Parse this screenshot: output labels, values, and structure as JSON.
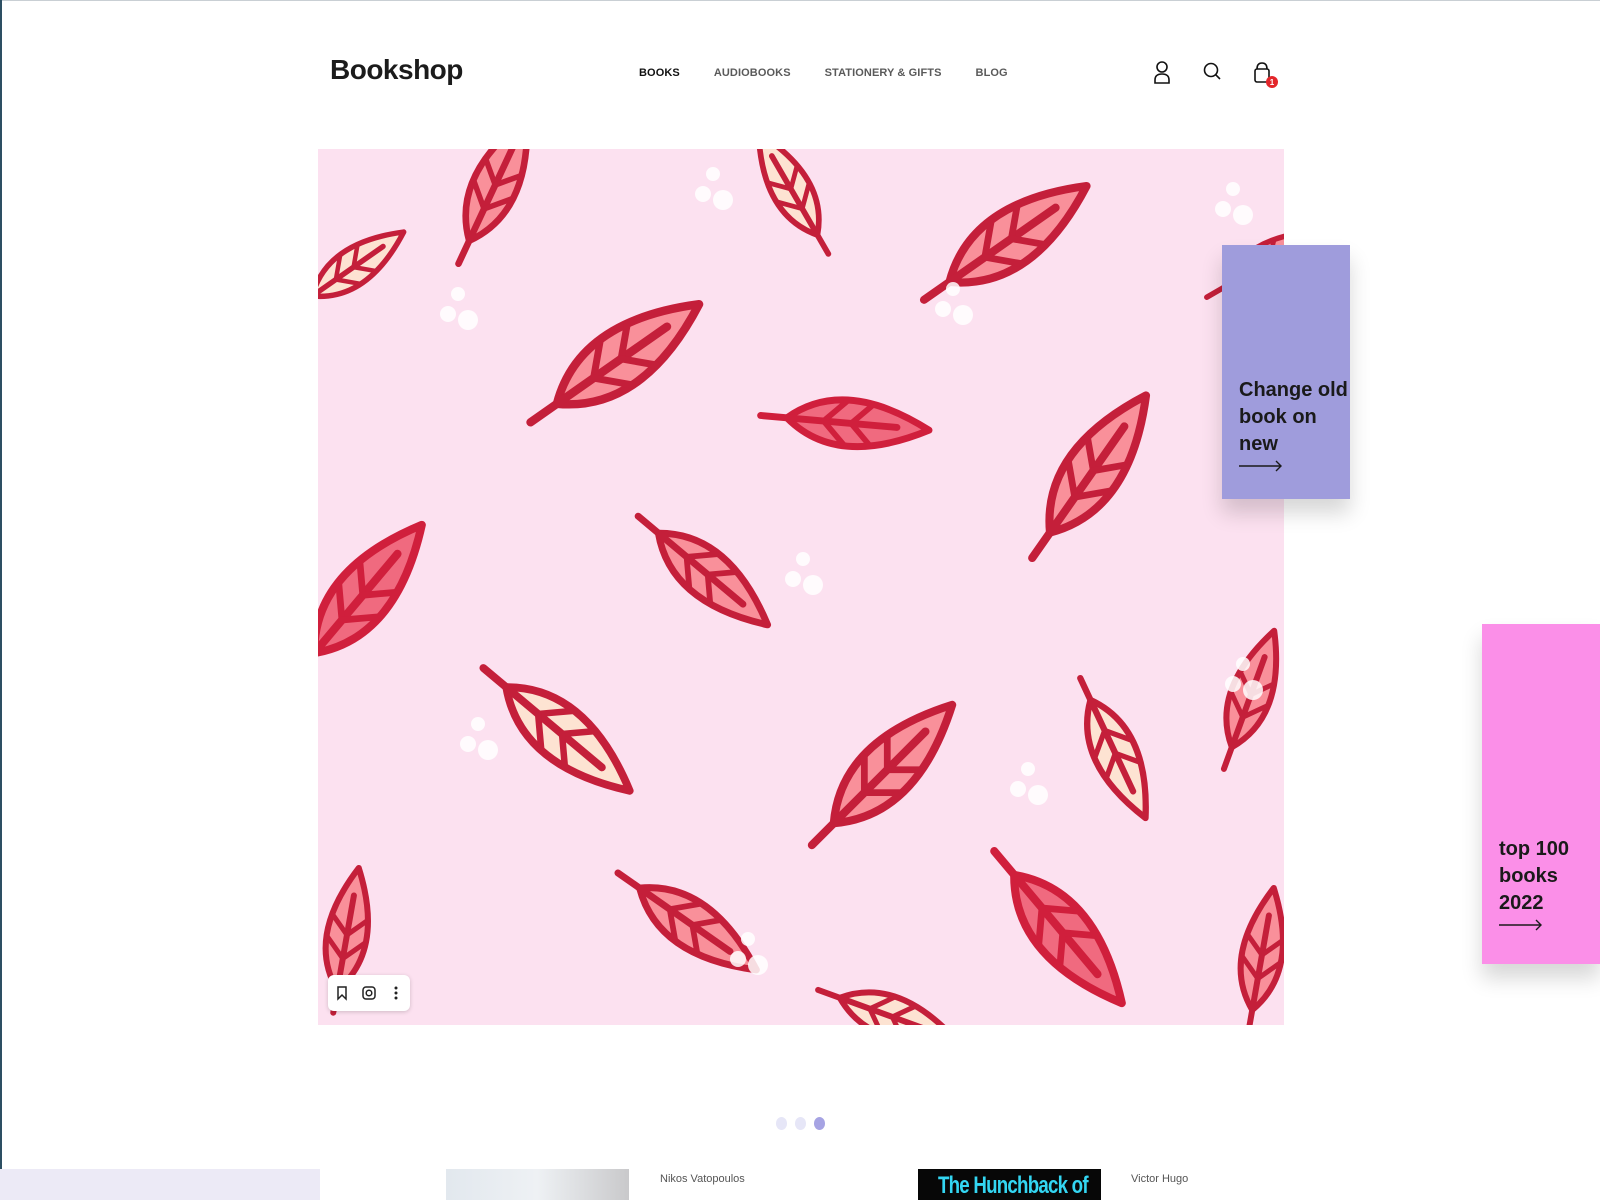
{
  "header": {
    "logo": "Bookshop",
    "nav": [
      {
        "label": "BOOKS",
        "active": true
      },
      {
        "label": "AUDIOBOOKS",
        "active": false
      },
      {
        "label": "STATIONERY & GIFTS",
        "active": false
      },
      {
        "label": "BLOG",
        "active": false
      }
    ],
    "icons": [
      "user-icon",
      "search-icon",
      "bag-icon"
    ],
    "cart_count": "1"
  },
  "hero": {
    "image": "pink leaf pattern",
    "toolbar_icons": [
      "bookmark-icon",
      "lens-icon",
      "more-icon"
    ]
  },
  "promos": [
    {
      "text_lines": [
        "Change old",
        "book on",
        "new"
      ],
      "color": "#9f9cdc"
    },
    {
      "text_lines": [
        "top 100",
        "books",
        "2022"
      ],
      "color": "#fb8fe8"
    }
  ],
  "carousel": {
    "count": 3,
    "active_index": 2
  },
  "books": [
    {
      "author": "Nikos Vatopoulos"
    },
    {
      "author": "Victor Hugo",
      "cover_text": "The Hunchback of"
    }
  ],
  "colors": {
    "accent": "#a6a3e3",
    "hero_bg": "#fce1f0",
    "leaf_red": "#d4223c",
    "leaf_fill": "#f9858f",
    "leaf_light": "#fde4d4"
  }
}
